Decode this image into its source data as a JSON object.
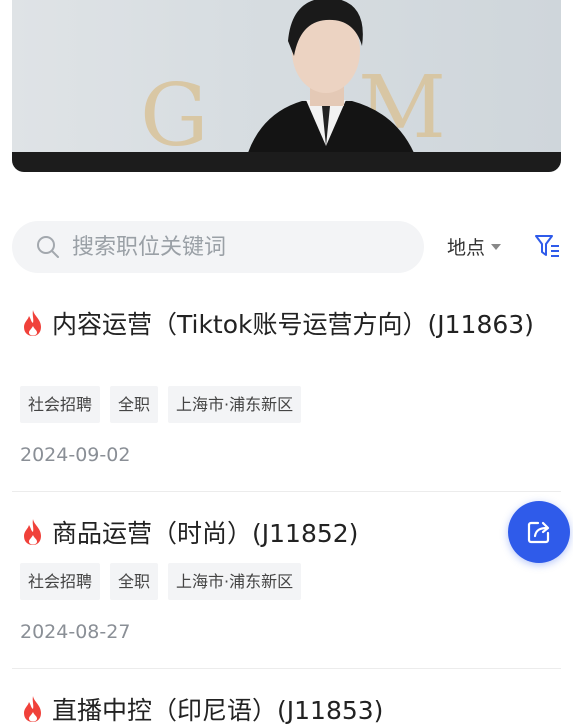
{
  "banner": {
    "letters": [
      "G",
      "M"
    ]
  },
  "search": {
    "placeholder": "搜索职位关键词"
  },
  "location_label": "地点",
  "jobs": [
    {
      "title": "内容运营（Tiktok账号运营方向）(J11863)",
      "tags": [
        "社会招聘",
        "全职",
        "上海市·浦东新区"
      ],
      "date": "2024-09-02"
    },
    {
      "title": "商品运营（时尚）(J11852)",
      "tags": [
        "社会招聘",
        "全职",
        "上海市·浦东新区"
      ],
      "date": "2024-08-27"
    },
    {
      "title": "直播中控（印尼语）(J11853)",
      "tags": [],
      "date": ""
    }
  ],
  "colors": {
    "accent": "#2f5bea",
    "hot": "#f0413a",
    "tag_bg": "#f3f4f6"
  },
  "icons": [
    "search-icon",
    "caret-down-icon",
    "filter-icon",
    "flame-icon",
    "share-icon"
  ]
}
